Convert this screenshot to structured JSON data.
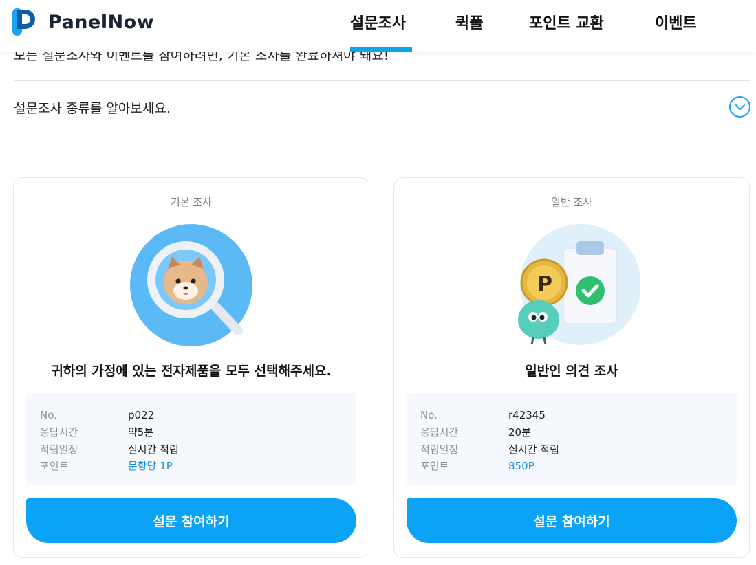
{
  "brand": {
    "name": "PanelNow",
    "accent": "#0ea5e9"
  },
  "nav": {
    "items": [
      {
        "label": "설문조사",
        "active": true
      },
      {
        "label": "퀵폴",
        "active": false
      },
      {
        "label": "포인트 교환",
        "active": false
      },
      {
        "label": "이벤트",
        "active": false
      }
    ]
  },
  "notice": "모든 설문조사와 이벤트를 참여하려면, 기본 조사를 완료하셔야 돼요!",
  "accordion": {
    "label": "설문조사 종류를 알아보세요.",
    "icon": "chevron-down-icon"
  },
  "cards": [
    {
      "type": "기본 조사",
      "illustration": "magnifier-dog-icon",
      "title": "귀하의 가정에 있는 전자제품을 모두 선택해주세요.",
      "rows": [
        {
          "label": "No.",
          "value": "p022"
        },
        {
          "label": "응답시간",
          "value": "약5분"
        },
        {
          "label": "적립일정",
          "value": "실시간 적립"
        },
        {
          "label": "포인트",
          "value": "문항당 1P"
        }
      ],
      "button": "설문 참여하기"
    },
    {
      "type": "일반 조사",
      "illustration": "clipboard-coin-bird-icon",
      "title": "일반인 의견 조사",
      "rows": [
        {
          "label": "No.",
          "value": "r42345"
        },
        {
          "label": "응답시간",
          "value": "20분"
        },
        {
          "label": "적립일정",
          "value": "실시간 적립"
        },
        {
          "label": "포인트",
          "value": "850P"
        }
      ],
      "button": "설문 참여하기"
    }
  ]
}
